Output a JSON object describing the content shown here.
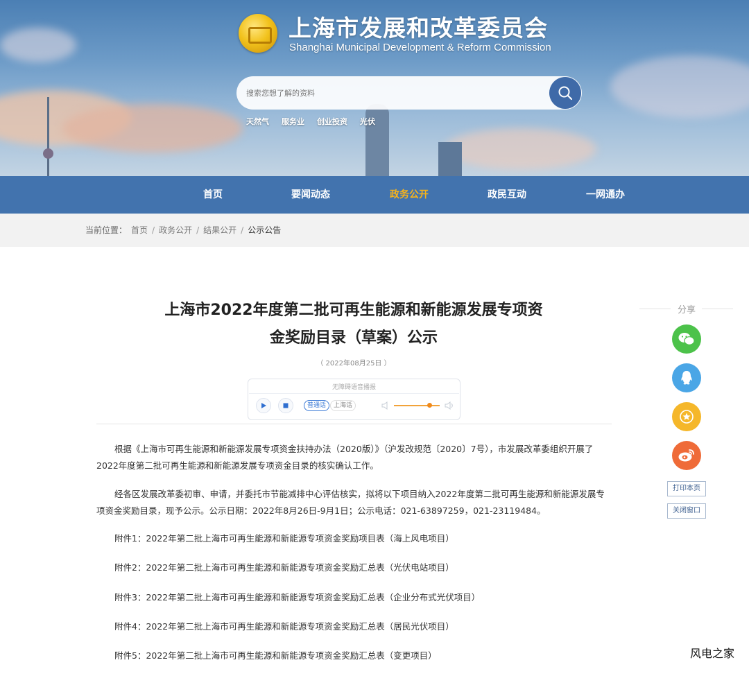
{
  "header": {
    "title": "上海市发展和改革委员会",
    "subtitle": "Shanghai Municipal Development & Reform Commission"
  },
  "search": {
    "placeholder": "搜索您想了解的资料",
    "hot_words": [
      "天然气",
      "服务业",
      "创业投资",
      "光伏"
    ]
  },
  "nav": {
    "items": [
      "首页",
      "要闻动态",
      "政务公开",
      "政民互动",
      "一网通办"
    ],
    "active": "政务公开"
  },
  "breadcrumb": {
    "prefix": "当前位置：",
    "items": [
      "首页",
      "政务公开",
      "结果公开"
    ],
    "separator": "/",
    "current": "公示公告"
  },
  "article": {
    "title_line1": "上海市2022年度第二批可再生能源和新能源发展专项资",
    "title_line2": "金奖励目录（草案）公示",
    "date": "（ 2022年08月25日 ）",
    "paragraphs": [
      "根据《上海市可再生能源和新能源发展专项资金扶持办法（2020版）》（沪发改规范〔2020〕7号），市发展改革委组织开展了2022年度第二批可再生能源和新能源发展专项资金目录的核实确认工作。",
      "经各区发展改革委初审、申请，并委托市节能减排中心评估核实，拟将以下项目纳入2022年度第二批可再生能源和新能源发展专项资金奖励目录，现予公示。公示日期：2022年8月26日-9月1日；公示电话：021-63897259，021-23119484。"
    ],
    "attachments": [
      "附件1：2022年第二批上海市可再生能源和新能源专项资金奖励项目表（海上风电项目）",
      "附件2：2022年第二批上海市可再生能源和新能源专项资金奖励汇总表（光伏电站项目）",
      "附件3：2022年第二批上海市可再生能源和新能源专项资金奖励汇总表（企业分布式光伏项目）",
      "附件4：2022年第二批上海市可再生能源和新能源专项资金奖励汇总表（居民光伏项目）",
      "附件5：2022年第二批上海市可再生能源和新能源专项资金奖励汇总表（变更项目）"
    ]
  },
  "player": {
    "caption": "无障碍语音播报",
    "lang_options": [
      "普通话",
      "上海话"
    ],
    "selected_lang": "普通话",
    "icons": [
      "play-icon",
      "stop-icon",
      "volume-low-icon",
      "volume-high-icon"
    ],
    "volume_level": 0.75
  },
  "share": {
    "label": "分享",
    "buttons": [
      {
        "name": "wechat",
        "icon": "wechat-icon",
        "color": "#4cc24a"
      },
      {
        "name": "qq",
        "icon": "qq-icon",
        "color": "#4aa6e6"
      },
      {
        "name": "favorite",
        "icon": "star-icon",
        "color": "#f5b72a"
      },
      {
        "name": "weibo",
        "icon": "weibo-icon",
        "color": "#ef6b38"
      }
    ],
    "print_label": "打印本页",
    "close_label": "关闭窗口"
  },
  "watermark": "风电之家",
  "colors": {
    "nav_bg": "#3468a8",
    "nav_active": "#f6b31c",
    "search_button": "#3f6aa8",
    "crumb_bg": "#f2f2f2"
  }
}
